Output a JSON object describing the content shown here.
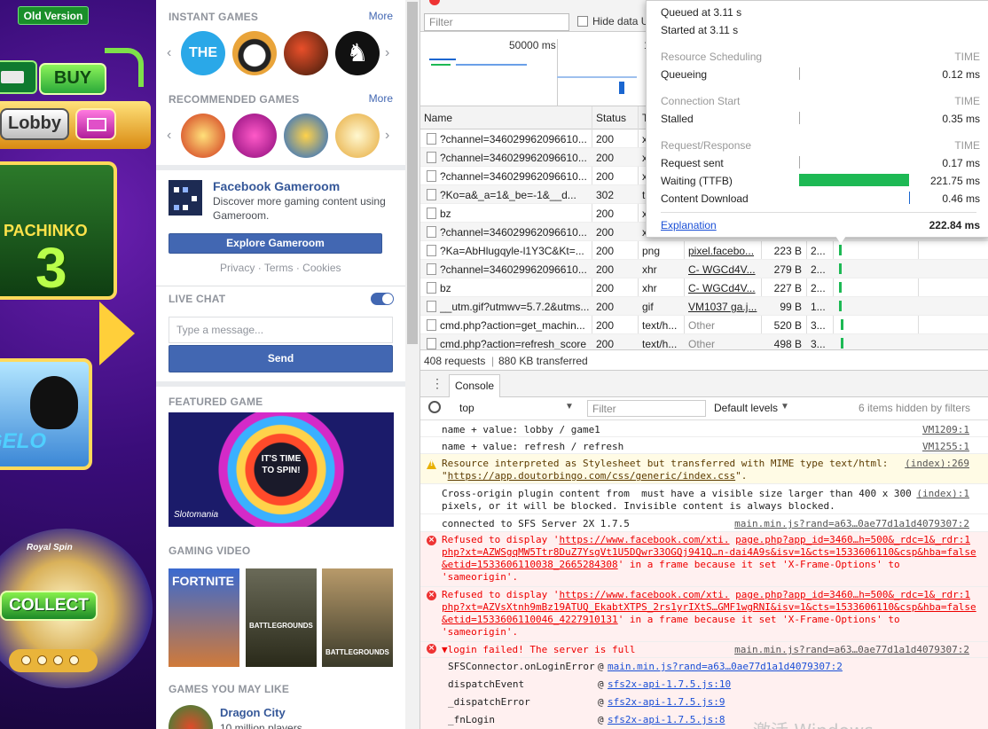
{
  "game": {
    "old_version": "Old Version",
    "buy": "BUY",
    "lobby": "Lobby",
    "pachinko": "PACHINKO",
    "pachinko_num": "3",
    "penguin_text": "GELO",
    "collect": "COLLECT",
    "royal_spin": "Royal Spin"
  },
  "fb": {
    "instant_games": "INSTANT GAMES",
    "more": "More",
    "instant_icons": [
      "the-test-icon",
      "8-ball-icon",
      "snake-icon",
      "chess-icon"
    ],
    "the_test": "THE TEST",
    "recommended_games": "RECOMMENDED GAMES",
    "recommended_icons": [
      "slotomania-icon",
      "bingo-bombo-icon",
      "slingo-icon",
      "our-bingo-icon"
    ],
    "gameroom_title": "Facebook Gameroom",
    "gameroom_desc_1": "Discover more gaming content using",
    "gameroom_desc_2": "Gameroom.",
    "explore_button": "Explore Gameroom",
    "privacy": "Privacy",
    "terms": "Terms",
    "cookies": "Cookies",
    "dot": "·",
    "live_chat": "LIVE CHAT",
    "message_placeholder": "Type a message...",
    "send": "Send",
    "featured_game": "FEATURED GAME",
    "spin_text": "IT'S TIME TO SPIN!",
    "slotomania": "Slotomania",
    "gaming_video": "GAMING VIDEO",
    "fortnite": "FORTNITE",
    "battlegrounds": "BATTLEGROUNDS",
    "games_you_may_like": "GAMES YOU MAY LIKE",
    "dragon_city": "Dragon City",
    "dragon_players": "10 million players"
  },
  "devtools": {
    "filter_placeholder": "Filter",
    "hide_data": "Hide data U",
    "overview_label": "50000 ms",
    "overview_label2": "1",
    "columns": [
      "Name",
      "Status",
      "T"
    ],
    "rows": [
      {
        "name": "?channel=346029962096610...",
        "status": "200",
        "type": "x",
        "init": "",
        "size": "",
        "time": ""
      },
      {
        "name": "?channel=346029962096610...",
        "status": "200",
        "type": "x",
        "init": "",
        "size": "",
        "time": ""
      },
      {
        "name": "?channel=346029962096610...",
        "status": "200",
        "type": "x",
        "init": "",
        "size": "",
        "time": ""
      },
      {
        "name": "?Ko=a&_a=1&_be=-1&__d...",
        "status": "302",
        "type": "t",
        "init": "",
        "size": "",
        "time": ""
      },
      {
        "name": "bz",
        "status": "200",
        "type": "x",
        "init": "",
        "size": "",
        "time": ""
      },
      {
        "name": "?channel=346029962096610...",
        "status": "200",
        "type": "x",
        "init": "",
        "size": "",
        "time": ""
      },
      {
        "name": "?Ka=AbHlugqyle-l1Y3C&Kt=...",
        "status": "200",
        "type": "png",
        "init": "pixel.facebo...",
        "size": "223 B",
        "time": "2..."
      },
      {
        "name": "?channel=346029962096610...",
        "status": "200",
        "type": "xhr",
        "init": "C- WGCd4V...",
        "size": "279 B",
        "time": "2..."
      },
      {
        "name": "bz",
        "status": "200",
        "type": "xhr",
        "init": "C- WGCd4V...",
        "size": "227 B",
        "time": "2..."
      },
      {
        "name": "__utm.gif?utmwv=5.7.2&utms...",
        "status": "200",
        "type": "gif",
        "init": "VM1037 ga.j...",
        "size": "99 B",
        "time": "1..."
      },
      {
        "name": "cmd.php?action=get_machin...",
        "status": "200",
        "type": "text/h...",
        "init": "Other",
        "size": "520 B",
        "time": "3..."
      },
      {
        "name": "cmd.php?action=refresh_score",
        "status": "200",
        "type": "text/h...",
        "init": "Other",
        "size": "498 B",
        "time": "3..."
      }
    ],
    "requests": "408 requests",
    "transferred": "880 KB transferred",
    "status_sep": "|",
    "console_tab": "Console",
    "context": "top",
    "console_filter": "Filter",
    "default_levels": "Default levels",
    "hidden_items": "6 items hidden by filters",
    "timing": {
      "queued": "Queued at 3.11 s",
      "started": "Started at 3.11 s",
      "resource_scheduling": "Resource Scheduling",
      "time_label": "TIME",
      "queueing": "Queueing",
      "queueing_val": "0.12 ms",
      "connection_start": "Connection Start",
      "stalled": "Stalled",
      "stalled_val": "0.35 ms",
      "request_response": "Request/Response",
      "request_sent": "Request sent",
      "request_sent_val": "0.17 ms",
      "waiting": "Waiting (TTFB)",
      "waiting_val": "221.75 ms",
      "content_download": "Content Download",
      "content_download_val": "0.46 ms",
      "explanation": "Explanation",
      "total": "222.84 ms"
    },
    "console": [
      {
        "kind": "log",
        "text": "name + value: lobby / game1",
        "src": "VM1209:1"
      },
      {
        "kind": "log",
        "text": "name + value: refresh / refresh",
        "src": "VM1255:1"
      },
      {
        "kind": "warn",
        "l1": "Resource interpreted as Stylesheet but transferred with MIME type text/html:",
        "l2a": "\"",
        "l2link": "https://app.doutorbingo.com/css/generic/index.css",
        "l2b": "\".",
        "src": "(index):269"
      },
      {
        "kind": "log",
        "l1": "Cross-origin plugin content from  must have a visible size larger than 400 x 300",
        "l2": "pixels, or it will be blocked. Invisible content is always blocked.",
        "src": "(index):1"
      },
      {
        "kind": "log",
        "text": "connected to SFS Server 2X 1.7.5",
        "src": "main.min.js?rand=a63…0ae77d1a1d4079307:2"
      },
      {
        "kind": "err",
        "l1a": "Refused to display '",
        "l1link": "https://www.facebook.com/xti.",
        "l1b": "page.php?app_id=3460…h=500&_rdc=1&_rdr:1",
        "l2": "php?xt=AZWSgqMW5Ttr8DuZ7YsgVt1U5DQwr33OGQj941Q…n-dai4A9s&isv=1&cts=1533606110&csp&hba=false",
        "l3a": "&etid=1533606110038_2665284308",
        "l3b": "' in a frame because it set 'X-Frame-Options' to",
        "l4": "'sameorigin'."
      },
      {
        "kind": "err",
        "l1a": "Refused to display '",
        "l1link": "https://www.facebook.com/xti.",
        "l1b": "page.php?app_id=3460…h=500&_rdc=1&_rdr:1",
        "l2": "php?xt=AZVsXtnh9mBz19ATUQ_EkabtXTPS_2rs1yrIXtS…GMF1wgRNI&isv=1&cts=1533606110&csp&hba=false",
        "l3a": "&etid=1533606110046_4227910131",
        "l3b": "' in a frame because it set 'X-Frame-Options' to",
        "l4": "'sameorigin'."
      },
      {
        "kind": "err",
        "text": "▼login failed! The server is full",
        "src": "main.min.js?rand=a63…0ae77d1a1d4079307:2"
      }
    ],
    "stack": [
      {
        "fn": "SFSConnector.onLoginError",
        "link": "main.min.js?rand=a63…0ae77d1a1d4079307:2"
      },
      {
        "fn": "dispatchEvent",
        "link": "sfs2x-api-1.7.5.js:10"
      },
      {
        "fn": "_dispatchError",
        "link": "sfs2x-api-1.7.5.js:9"
      },
      {
        "fn": "_fnLogin",
        "link": "sfs2x-api-1.7.5.js:8"
      }
    ],
    "at": "@",
    "watermark": "激活 Windows"
  }
}
